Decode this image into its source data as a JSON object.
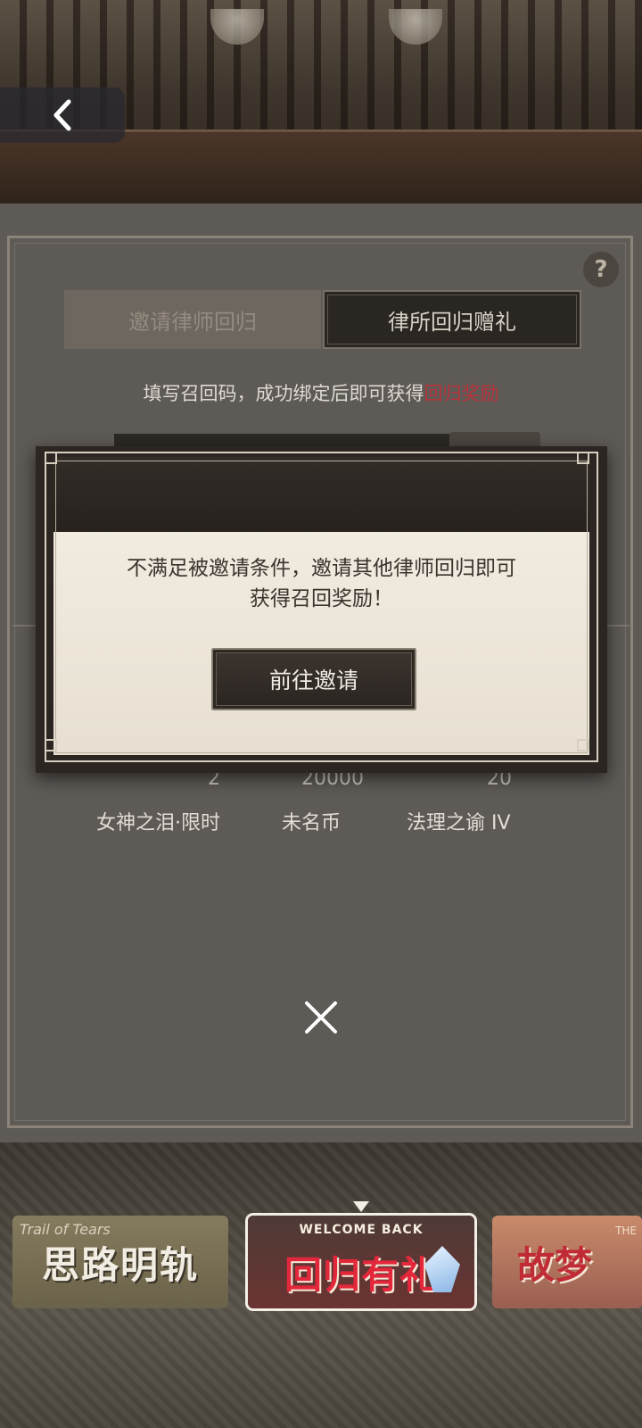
{
  "header": {
    "back_icon": "chevron-left-icon"
  },
  "help": {
    "label": "?"
  },
  "tabs": [
    {
      "label": "邀请律师回归",
      "active": false
    },
    {
      "label": "律所回归赠礼",
      "active": true
    }
  ],
  "instruction": {
    "text": "填写召回码，成功绑定后即可获得",
    "highlight": "回归奖励",
    "highlight_color": "#b5323a"
  },
  "rewards": [
    {
      "count": "2",
      "name": "女神之泪·限时"
    },
    {
      "count": "20000",
      "name": "未名币"
    },
    {
      "count": "20",
      "name": "法理之谕 IV"
    }
  ],
  "modal": {
    "message_line1": "不满足被邀请条件，邀请其他律师回归即可",
    "message_line2": "获得召回奖励！",
    "button_label": "前往邀请"
  },
  "close_icon": "close-icon",
  "banners": [
    {
      "title": "思路明轨",
      "subtitle": "Trail of Tears",
      "selected": false
    },
    {
      "welcome": "WELCOME BACK",
      "title": "回归有礼",
      "selected": true
    },
    {
      "title": "故梦",
      "subtitle": "THE",
      "selected": false
    }
  ]
}
